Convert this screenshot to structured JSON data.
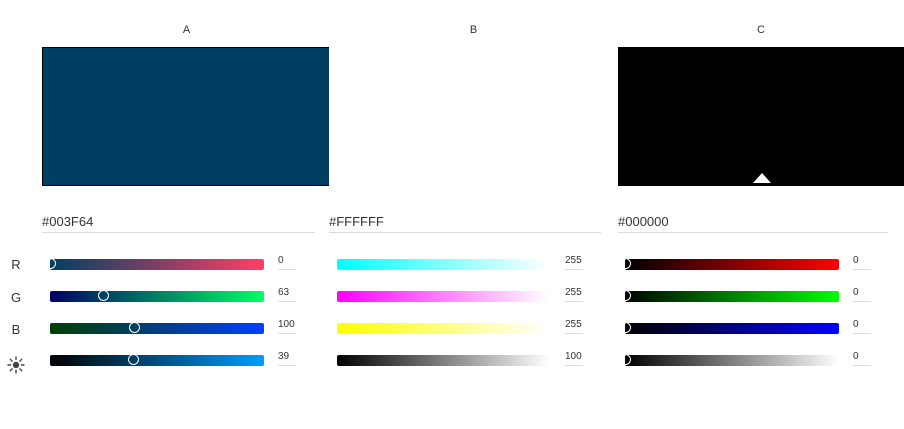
{
  "columns": [
    {
      "label": "A",
      "hex": "#003F64",
      "swatch_color": "#003F64",
      "values": [
        "0",
        "63",
        "100",
        "39"
      ],
      "levels": [
        0,
        63,
        100,
        39
      ],
      "max": [
        255,
        255,
        255,
        100
      ],
      "gradients": [
        "linear-gradient(to right,#003f64,#ff3f64)",
        "linear-gradient(to right,#000064,#00ff64)",
        "linear-gradient(to right,#003f00,#003fff)",
        "linear-gradient(to right,#000000,#009dff)"
      ]
    },
    {
      "label": "B",
      "hex": "#FFFFFF",
      "swatch_color": "#FFFFFF",
      "values": [
        "255",
        "255",
        "255",
        "100"
      ],
      "levels": [
        255,
        255,
        255,
        100
      ],
      "max": [
        255,
        255,
        255,
        100
      ],
      "gradients": [
        "linear-gradient(to right,#00ffff,#ffffff)",
        "linear-gradient(to right,#ff00ff,#ffffff)",
        "linear-gradient(to right,#ffff00,#ffffff)",
        "linear-gradient(to right,#000000,#ffffff)"
      ]
    },
    {
      "label": "C",
      "hex": "#000000",
      "swatch_color": "#000000",
      "values": [
        "0",
        "0",
        "0",
        "0"
      ],
      "levels": [
        0,
        0,
        0,
        0
      ],
      "max": [
        255,
        255,
        255,
        100
      ],
      "gradients": [
        "linear-gradient(to right,#000000,#ff0000)",
        "linear-gradient(to right,#000000,#00ff00)",
        "linear-gradient(to right,#000000,#0000ff)",
        "linear-gradient(to right,#000000,#ffffff)"
      ]
    }
  ],
  "row_labels": [
    "R",
    "G",
    "B"
  ],
  "brightness_icon": "sun-icon"
}
